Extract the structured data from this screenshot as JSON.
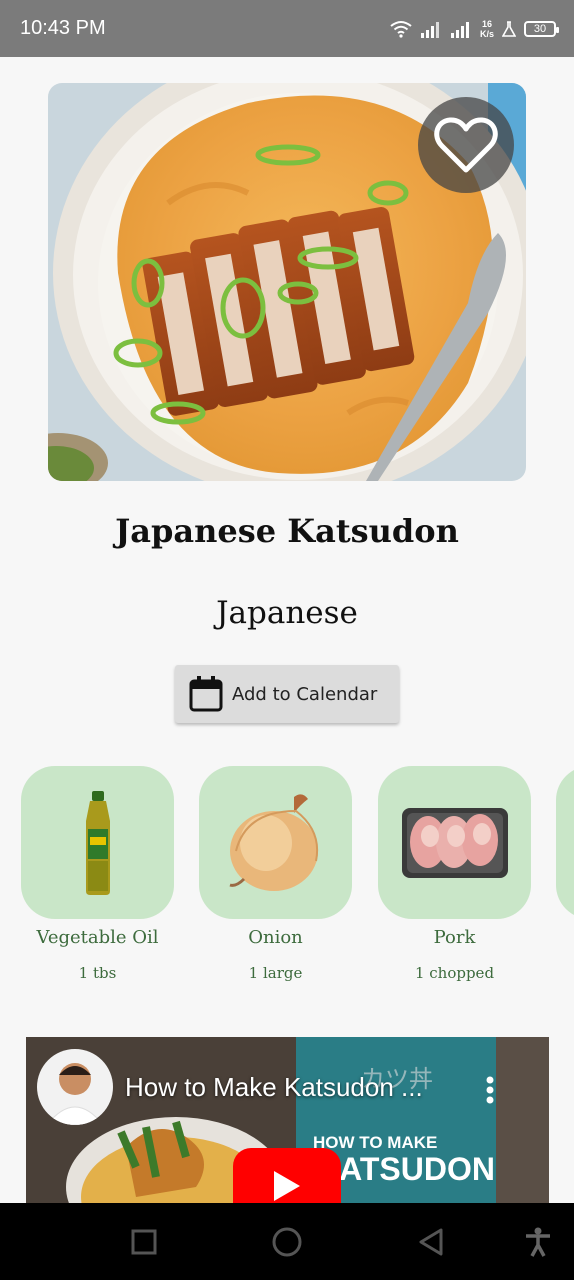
{
  "status_bar": {
    "time": "10:43 PM",
    "net_speed_value": "16",
    "net_speed_unit": "K/s",
    "battery": "30"
  },
  "recipe": {
    "title": "Japanese Katsudon",
    "cuisine": "Japanese",
    "favorite_icon": "heart-outline-icon"
  },
  "calendar_button": {
    "label": "Add to Calendar",
    "icon": "calendar-icon"
  },
  "ingredients": [
    {
      "name": "Vegetable Oil",
      "quantity": "1 tbs"
    },
    {
      "name": "Onion",
      "quantity": "1 large"
    },
    {
      "name": "Pork",
      "quantity": "1 chopped"
    }
  ],
  "video": {
    "title": "How to Make Katsudon ...",
    "thumb_text_line1": "HOW TO MAKE",
    "thumb_text_line2": "KATSUDON",
    "thumb_kanji": "カツ丼"
  },
  "colors": {
    "ingredient_card_bg": "#c9e6c8",
    "ingredient_text": "#3d6b3d",
    "youtube_red": "#ff0000",
    "status_bar_bg": "#7b7b7b"
  }
}
